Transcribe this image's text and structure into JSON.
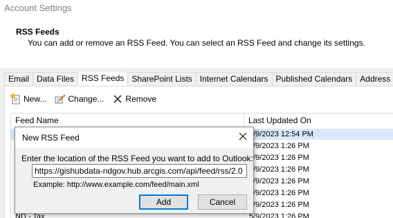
{
  "window": {
    "title": "Account Settings"
  },
  "header": {
    "title": "RSS Feeds",
    "description": "You can add or remove an RSS Feed. You can select an RSS Feed and change its settings."
  },
  "tabs": [
    {
      "label": "Email",
      "active": false
    },
    {
      "label": "Data Files",
      "active": false
    },
    {
      "label": "RSS Feeds",
      "active": true
    },
    {
      "label": "SharePoint Lists",
      "active": false
    },
    {
      "label": "Internet Calendars",
      "active": false
    },
    {
      "label": "Published Calendars",
      "active": false
    },
    {
      "label": "Address Boo",
      "active": false
    }
  ],
  "toolbar": {
    "new_label": "New...",
    "change_label": "Change...",
    "remove_label": "Remove",
    "new_icon": "new-feed-icon",
    "change_icon": "change-feed-icon",
    "remove_icon": "remove-x-icon"
  },
  "list": {
    "columns": [
      "Feed Name",
      "Last Updated On"
    ],
    "rows": [
      {
        "name": "",
        "date": "5/9/2023 12:54 PM",
        "selected": true
      },
      {
        "name": "",
        "date": "5/9/2023 1:26 PM",
        "selected": false
      },
      {
        "name": "",
        "date": "5/9/2023 1:26 PM",
        "selected": false
      },
      {
        "name": "",
        "date": "5/9/2023 1:26 PM",
        "selected": false
      },
      {
        "name": "",
        "date": "5/9/2023 1:26 PM",
        "selected": false
      },
      {
        "name": "",
        "date": "5/9/2023 1:26 PM",
        "selected": false
      },
      {
        "name": "",
        "date": "5/9/2023 1:26 PM",
        "selected": false
      },
      {
        "name": "ND - Tax",
        "date": "5/9/2023 1:26 PM",
        "selected": false
      }
    ]
  },
  "dialog": {
    "title": "New RSS Feed",
    "prompt": "Enter the location of the RSS Feed you want to add to Outlook:",
    "input_value": "https://gishubdata-ndgov.hub.arcgis.com/api/feed/rss/2.0",
    "example": "Example: http://www.example.com/feed/main.xml",
    "add_label": "Add",
    "cancel_label": "Cancel",
    "close_icon": "close-icon"
  },
  "colors": {
    "accent": "#0078d7",
    "selection": "#d9e8fb",
    "panel_bg": "#f0f0f0"
  }
}
